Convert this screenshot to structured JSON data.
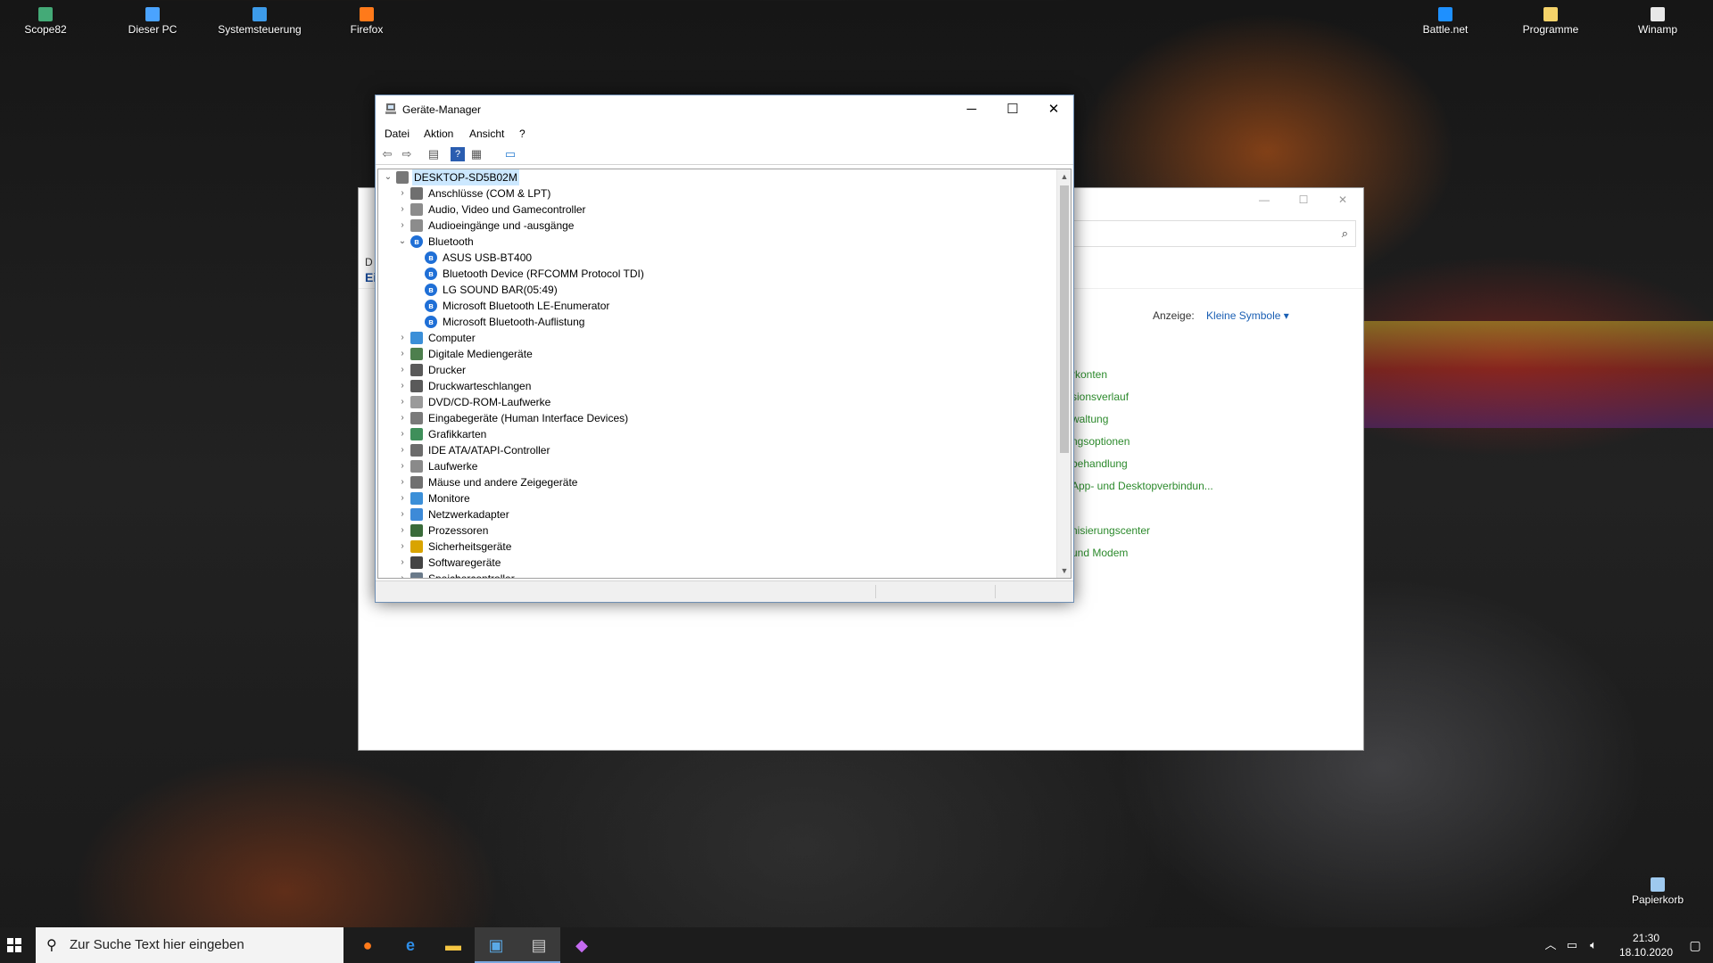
{
  "desktop": {
    "icons_left": [
      {
        "label": "Scope82",
        "icon": "user-icon",
        "color": "#4a7"
      },
      {
        "label": "Dieser PC",
        "icon": "computer-icon",
        "color": "#4aa3ff"
      },
      {
        "label": "Systemsteuerung",
        "icon": "control-panel-icon",
        "color": "#3d9be9"
      },
      {
        "label": "Firefox",
        "icon": "firefox-icon",
        "color": "#ff7a1a"
      }
    ],
    "icons_right": [
      {
        "label": "Battle.net",
        "icon": "battlenet-icon",
        "color": "#1e90ff"
      },
      {
        "label": "Programme",
        "icon": "folder-icon",
        "color": "#f5d36a"
      },
      {
        "label": "Winamp",
        "icon": "winamp-icon",
        "color": "#e8e8e8"
      }
    ],
    "recycle_bin": {
      "label": "Papierkorb",
      "icon": "recycle-bin-icon"
    }
  },
  "control_panel": {
    "left_text": "D",
    "left_heading": "Ei",
    "view_label": "Anzeige:",
    "view_value": "Kleine Symbole",
    "links": [
      "rkonten",
      "sionsverlauf",
      "waltung",
      "ngsoptionen",
      "behandlung",
      "App- und Desktopverbindun...",
      "",
      "nisierungscenter",
      "und Modem"
    ]
  },
  "device_manager": {
    "title": "Geräte-Manager",
    "menu": [
      "Datei",
      "Aktion",
      "Ansicht",
      "?"
    ],
    "root": "DESKTOP-SD5B02M",
    "categories": [
      {
        "label": "Anschlüsse (COM & LPT)",
        "expanded": false,
        "icon": "port-icon"
      },
      {
        "label": "Audio, Video und Gamecontroller",
        "expanded": false,
        "icon": "speaker-icon"
      },
      {
        "label": "Audioeingänge und -ausgänge",
        "expanded": false,
        "icon": "speaker-icon"
      },
      {
        "label": "Bluetooth",
        "expanded": true,
        "icon": "bluetooth-icon",
        "children": [
          "ASUS USB-BT400",
          "Bluetooth Device (RFCOMM Protocol TDI)",
          "LG SOUND BAR(05:49)",
          "Microsoft Bluetooth LE-Enumerator",
          "Microsoft Bluetooth-Auflistung"
        ]
      },
      {
        "label": "Computer",
        "expanded": false,
        "icon": "monitor-icon"
      },
      {
        "label": "Digitale Mediengeräte",
        "expanded": false,
        "icon": "media-device-icon"
      },
      {
        "label": "Drucker",
        "expanded": false,
        "icon": "printer-icon"
      },
      {
        "label": "Druckwarteschlangen",
        "expanded": false,
        "icon": "printer-icon"
      },
      {
        "label": "DVD/CD-ROM-Laufwerke",
        "expanded": false,
        "icon": "disc-icon"
      },
      {
        "label": "Eingabegeräte (Human Interface Devices)",
        "expanded": false,
        "icon": "hid-icon"
      },
      {
        "label": "Grafikkarten",
        "expanded": false,
        "icon": "display-adapter-icon"
      },
      {
        "label": "IDE ATA/ATAPI-Controller",
        "expanded": false,
        "icon": "controller-icon"
      },
      {
        "label": "Laufwerke",
        "expanded": false,
        "icon": "drive-icon"
      },
      {
        "label": "Mäuse und andere Zeigegeräte",
        "expanded": false,
        "icon": "mouse-icon"
      },
      {
        "label": "Monitore",
        "expanded": false,
        "icon": "monitor-icon"
      },
      {
        "label": "Netzwerkadapter",
        "expanded": false,
        "icon": "network-icon"
      },
      {
        "label": "Prozessoren",
        "expanded": false,
        "icon": "cpu-icon"
      },
      {
        "label": "Sicherheitsgeräte",
        "expanded": false,
        "icon": "security-icon"
      },
      {
        "label": "Softwaregeräte",
        "expanded": false,
        "icon": "software-device-icon"
      },
      {
        "label": "Speichercontroller",
        "expanded": false,
        "icon": "storage-controller-icon"
      }
    ]
  },
  "taskbar": {
    "search_placeholder": "Zur Suche Text hier eingeben",
    "time": "21:30",
    "date": "18.10.2020"
  }
}
